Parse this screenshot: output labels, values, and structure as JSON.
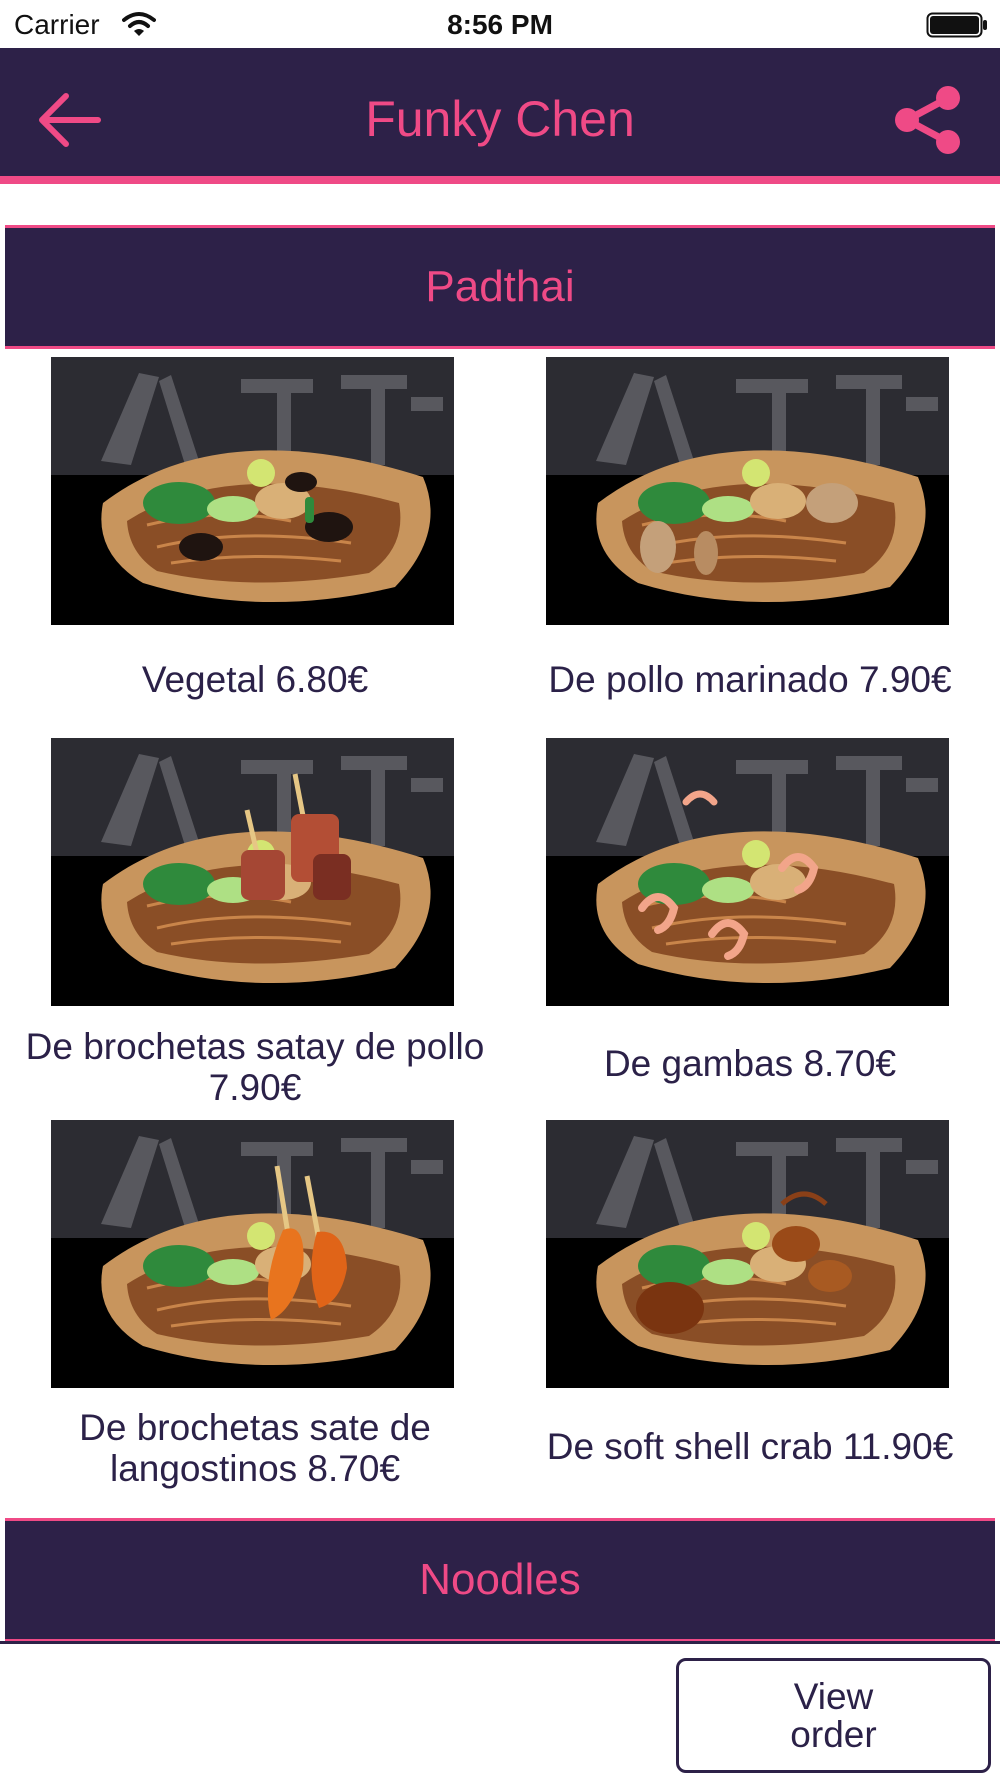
{
  "status_bar": {
    "carrier": "Carrier",
    "time": "8:56 PM",
    "wifi_icon": "wifi-icon",
    "battery_icon": "battery-icon"
  },
  "nav_bar": {
    "title": "Funky Chen",
    "back_icon": "arrow-left-icon",
    "share_icon": "share-icon"
  },
  "colors": {
    "primary": "#2d2148",
    "accent": "#ef4a86"
  },
  "sections": [
    {
      "title": "Padthai",
      "items": [
        {
          "label": "Vegetal 6.80€",
          "topping": "mushroom"
        },
        {
          "label": "De pollo marinado 7.90€",
          "topping": "chicken"
        },
        {
          "label": "De brochetas satay de pollo 7.90€",
          "topping": "skewer-chicken"
        },
        {
          "label": "De gambas 8.70€",
          "topping": "shrimp"
        },
        {
          "label": "De brochetas sate de langostinos 8.70€",
          "topping": "skewer-prawn"
        },
        {
          "label": "De soft shell crab 11.90€",
          "topping": "crab"
        }
      ]
    },
    {
      "title": "Noodles",
      "items": []
    }
  ],
  "footer": {
    "view_order_label": "View order"
  }
}
